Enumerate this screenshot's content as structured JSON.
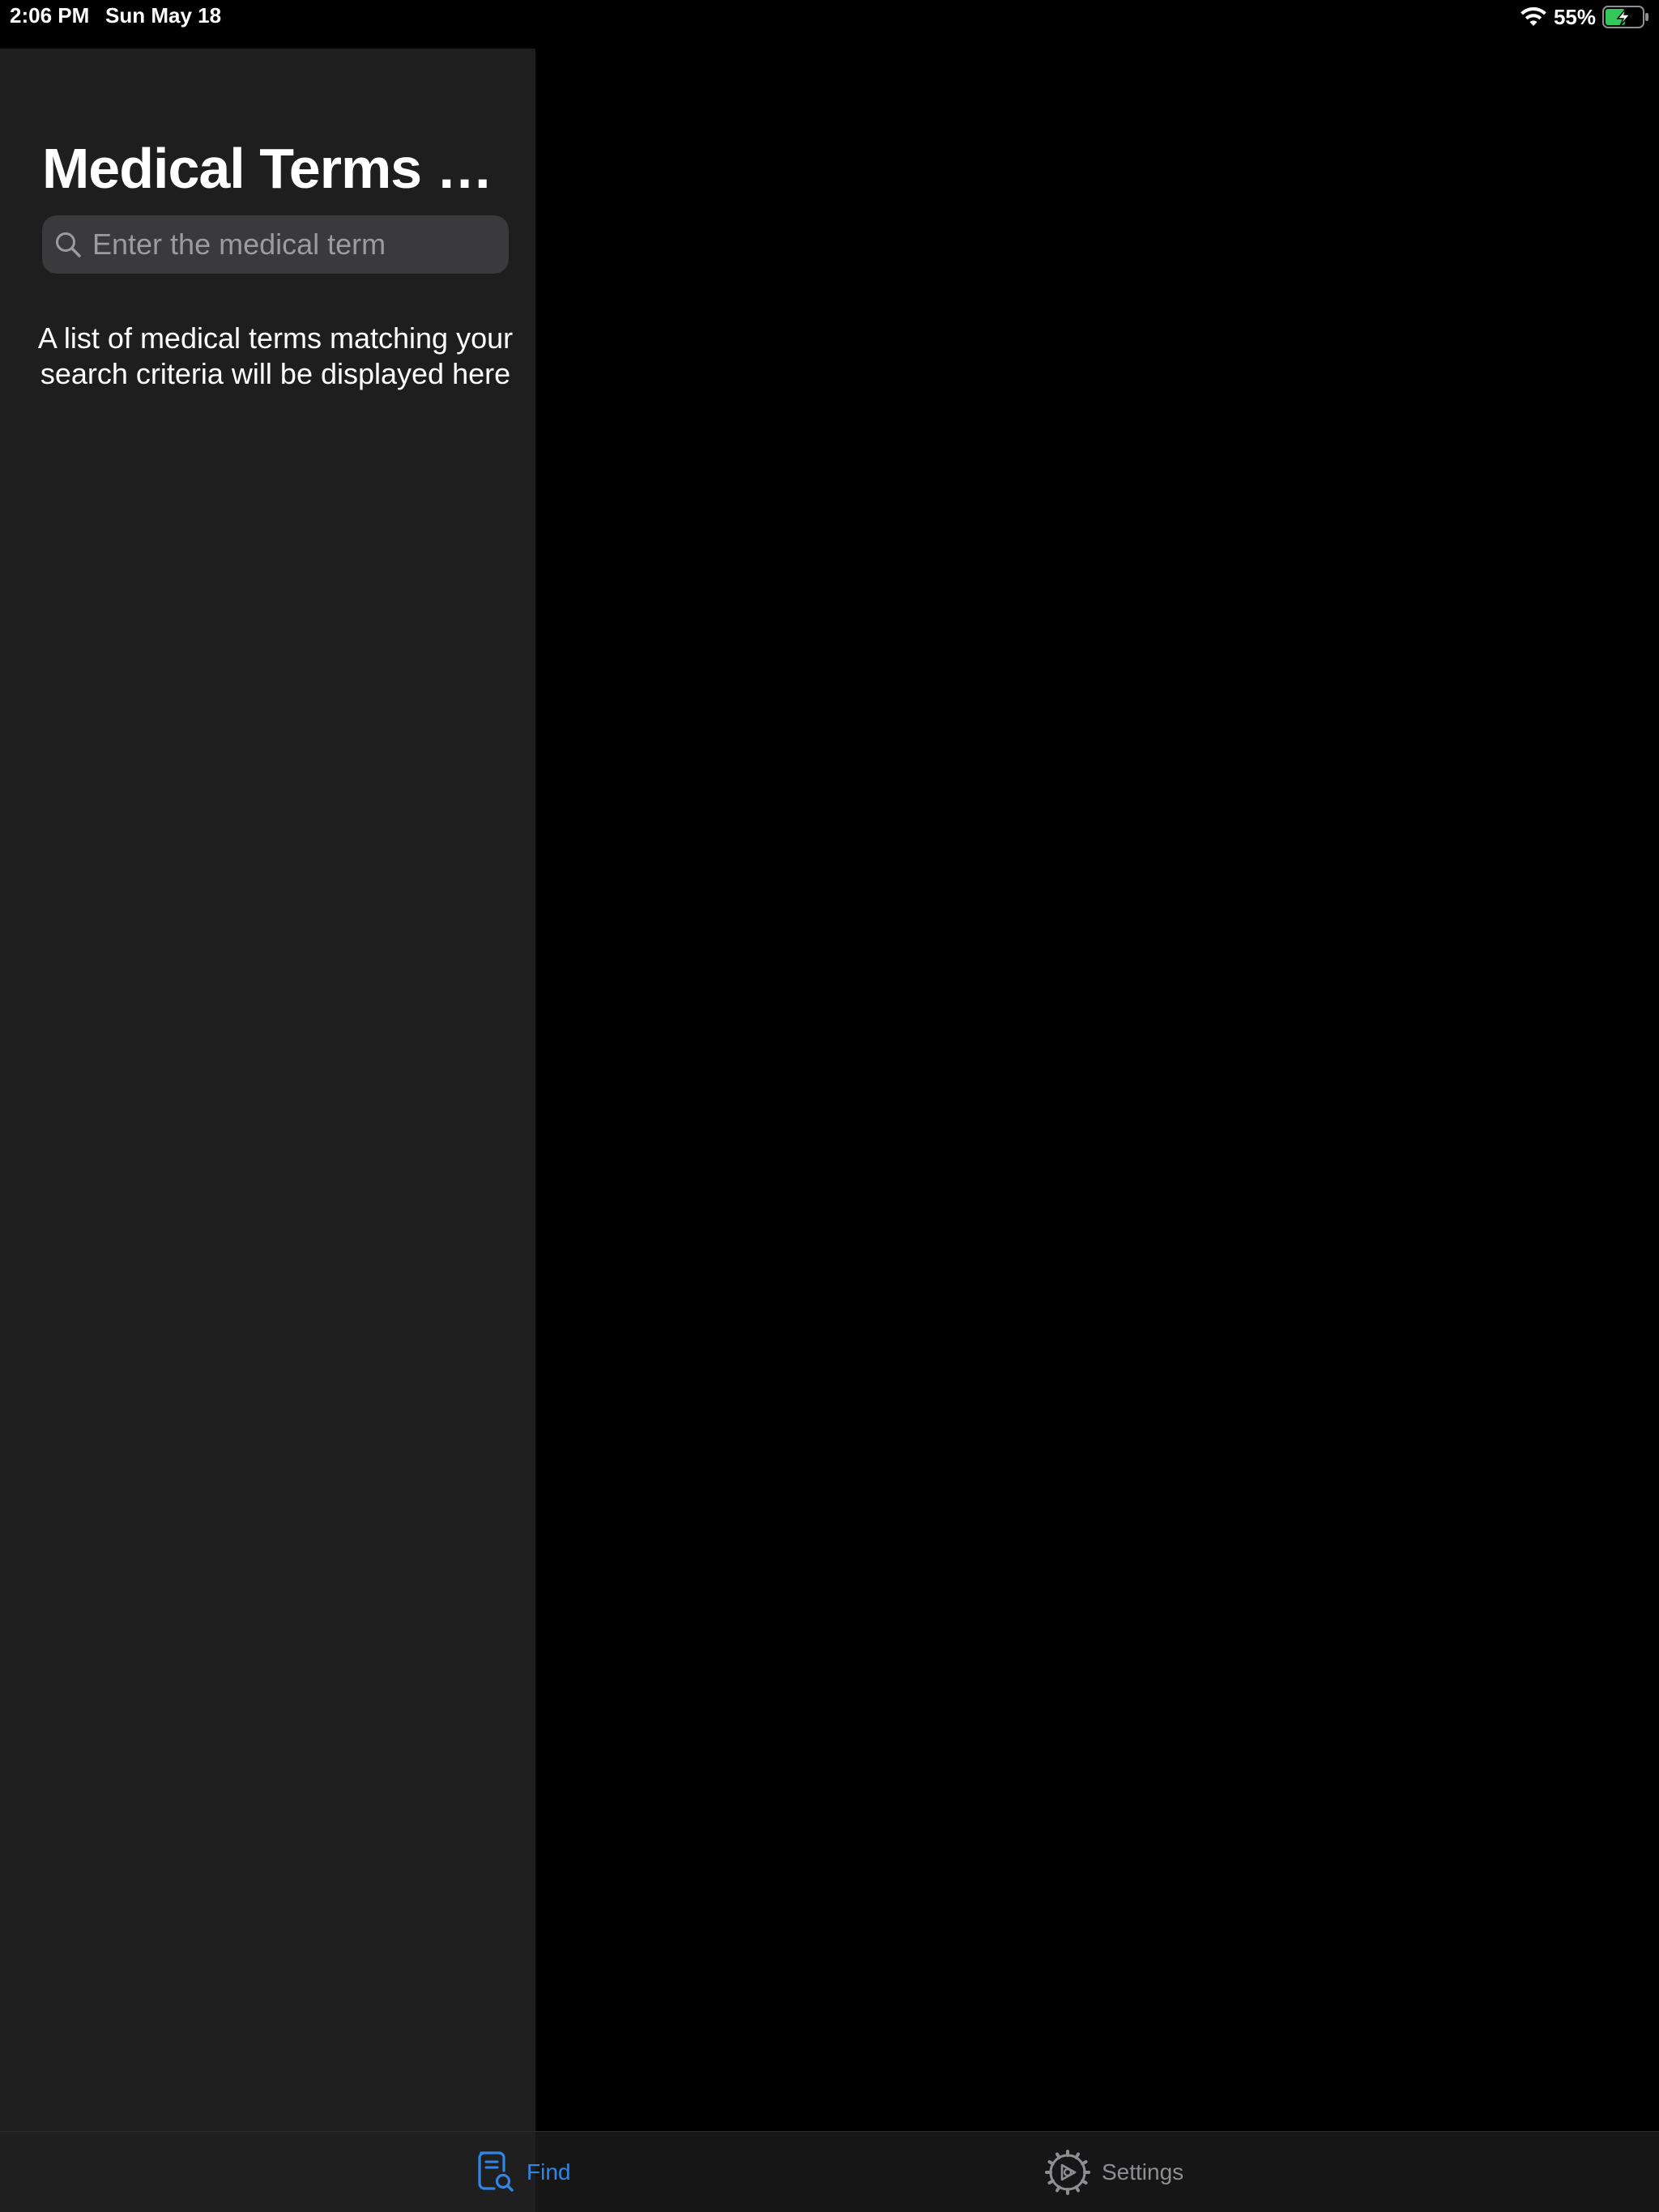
{
  "status_bar": {
    "time": "2:06 PM",
    "date": "Sun May 18",
    "battery_percent": "55%",
    "battery_level": 0.55,
    "charging": true,
    "icons": [
      "wifi-icon",
      "battery-charging-icon"
    ]
  },
  "sidebar": {
    "title": "Medical Terms S...",
    "search": {
      "placeholder": "Enter the medical term",
      "value": ""
    },
    "empty_message": "A list of medical terms matching your search criteria will be displayed here"
  },
  "tab_bar": {
    "tabs": [
      {
        "label": "Find",
        "icon": "document-search-icon",
        "selected": true
      },
      {
        "label": "Settings",
        "icon": "gear-icon",
        "selected": false
      }
    ]
  },
  "colors": {
    "background": "#000000",
    "sidebar": "#1e1e1f",
    "search_field": "#3a3a3c",
    "accent": "#2f86e6",
    "inactive_tab": "#8e8e93",
    "battery_fill": "#34c759"
  }
}
